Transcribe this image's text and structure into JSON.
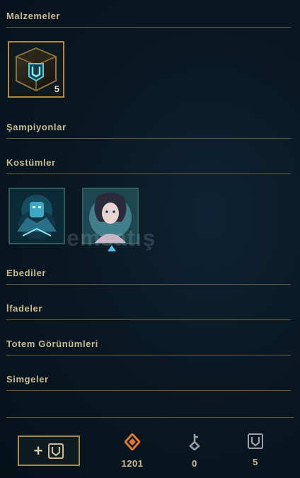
{
  "sections": {
    "materials": {
      "title": "Malzemeler",
      "items": [
        {
          "name": "hextech-chest",
          "count": "5"
        }
      ]
    },
    "champions": {
      "title": "Şampiyonlar"
    },
    "skins": {
      "title": "Kostümler"
    },
    "eternals": {
      "title": "Ebediler"
    },
    "emotes": {
      "title": "İfadeler"
    },
    "ward_skins": {
      "title": "Totem Görünümleri"
    },
    "icons": {
      "title": "Simgeler"
    }
  },
  "watermark": "emsatış",
  "footer": {
    "craft_button_label": "+",
    "currencies": [
      {
        "name": "orange-essence",
        "amount": "1201",
        "color": "#e07a2a"
      },
      {
        "name": "key-fragment",
        "amount": "0",
        "color": "#9aa0a4"
      },
      {
        "name": "chest",
        "amount": "5",
        "color": "#9aa0a4"
      }
    ]
  }
}
